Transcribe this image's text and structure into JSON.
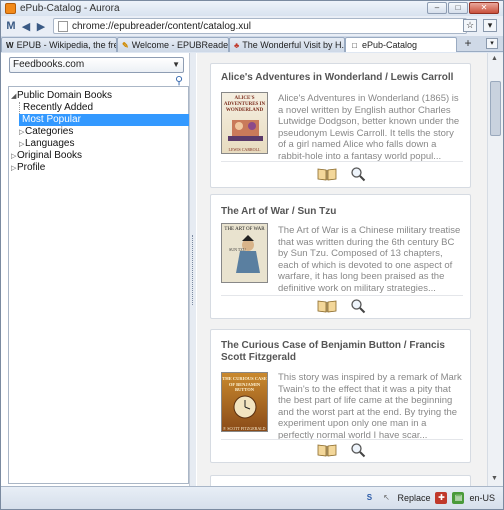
{
  "window": {
    "title": "ePub-Catalog - Aurora"
  },
  "navbar": {
    "url": "chrome://epubreader/content/catalog.xul"
  },
  "tabs": [
    {
      "label": "EPUB - Wikipedia, the free ...",
      "fav": "W"
    },
    {
      "label": "Welcome - EPUBReader",
      "fav": "✎"
    },
    {
      "label": "The Wonderful Visit by H. ...",
      "fav": "♣"
    },
    {
      "label": "ePub-Catalog",
      "fav": "□"
    }
  ],
  "sidebar": {
    "catalog_selected": "Feedbooks.com",
    "tree": [
      {
        "label": "Public Domain Books",
        "twisty": "◢"
      },
      {
        "label": "Recently Added"
      },
      {
        "label": "Most Popular",
        "selected": true
      },
      {
        "label": "Categories",
        "twisty": "▷"
      },
      {
        "label": "Languages",
        "twisty": "▷"
      },
      {
        "label": "Original Books",
        "twisty": "▷"
      },
      {
        "label": "Profile",
        "twisty": "▷"
      }
    ]
  },
  "books": [
    {
      "title": "Alice's Adventures in Wonderland / Lewis Carroll",
      "description": "Alice's Adventures in Wonderland (1865) is a novel written by English author Charles Lutwidge Dodgson, better known under the pseudonym Lewis Carroll. It tells the story of a girl named Alice who falls down a rabbit-hole into a fantasy world popul...",
      "cover_text": "ALICE'S ADVENTURES IN WONDERLAND",
      "cover_author": "LEWIS CARROLL"
    },
    {
      "title": "The Art of War / Sun Tzu",
      "description": "The Art of War is a Chinese military treatise that was written during the 6th century BC by Sun Tzu. Composed of 13 chapters, each of which is devoted to one aspect of warfare, it has long been praised as the definitive work on military strategies...",
      "cover_text": "THE ART OF WAR",
      "cover_author": "SUN TZU"
    },
    {
      "title": "The Curious Case of Benjamin Button / Francis Scott Fitzgerald",
      "description": "This story was inspired by a remark of Mark Twain's to the effect that it was a pity that the best part of life came at the beginning and the worst part at the end. By trying the experiment upon only one man in a perfectly normal world I have scar...",
      "cover_text": "THE CURIOUS CASE OF BENJAMIN BUTTON",
      "cover_author": "F. SCOTT FITZGERALD"
    }
  ],
  "statusbar": {
    "replace_label": "Replace",
    "locale": "en-US"
  },
  "colors": {
    "selection": "#3399ff",
    "card_border": "#d6dbe2",
    "title_grey": "#555555",
    "desc_grey": "#888888"
  }
}
